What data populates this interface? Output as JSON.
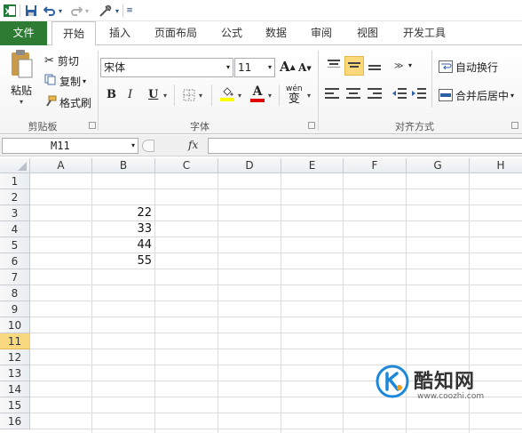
{
  "quick_access": {
    "app_icon": "excel-icon",
    "icons": [
      "save-icon",
      "undo-icon",
      "redo-icon",
      "tools-icon",
      "customize-icon"
    ]
  },
  "tabs": [
    {
      "label": "文件"
    },
    {
      "label": "开始"
    },
    {
      "label": "插入"
    },
    {
      "label": "页面布局"
    },
    {
      "label": "公式"
    },
    {
      "label": "数据"
    },
    {
      "label": "审阅"
    },
    {
      "label": "视图"
    },
    {
      "label": "开发工具"
    }
  ],
  "ribbon": {
    "clipboard": {
      "paste": "粘贴",
      "cut": "剪切",
      "copy": "复制",
      "format_painter": "格式刷",
      "group_label": "剪贴板"
    },
    "font": {
      "font_name": "宋体",
      "font_size": "11",
      "bold": "B",
      "italic": "I",
      "underline": "U",
      "grow": "A",
      "shrink": "A",
      "color_a": "A",
      "phonetic": "wén",
      "phonetic_char": "变",
      "group_label": "字体"
    },
    "alignment": {
      "wrap_text": "自动换行",
      "merge_center": "合并后居中",
      "group_label": "对齐方式"
    }
  },
  "formula_bar": {
    "name_box": "M11",
    "fx": "fx",
    "formula": ""
  },
  "sheet": {
    "columns": [
      "A",
      "B",
      "C",
      "D",
      "E",
      "F",
      "G",
      "H"
    ],
    "rows": [
      "1",
      "2",
      "3",
      "4",
      "5",
      "6",
      "7",
      "8",
      "9",
      "10",
      "11",
      "12",
      "13",
      "14",
      "15",
      "16"
    ],
    "selected_row": "11",
    "cells": [
      {
        "ref": "B3",
        "value": "22"
      },
      {
        "ref": "B4",
        "value": "33"
      },
      {
        "ref": "B5",
        "value": "44"
      },
      {
        "ref": "B6",
        "value": "55"
      }
    ]
  },
  "watermark": {
    "brand": "酷知网",
    "url": "www.coozhi.com"
  },
  "colors": {
    "file_tab": "#2e7b34",
    "selected_row_header": "#f9d97f",
    "highlight_yellow": "#ffff00",
    "font_red": "#e00000",
    "watermark_blue": "#1e88d8"
  }
}
